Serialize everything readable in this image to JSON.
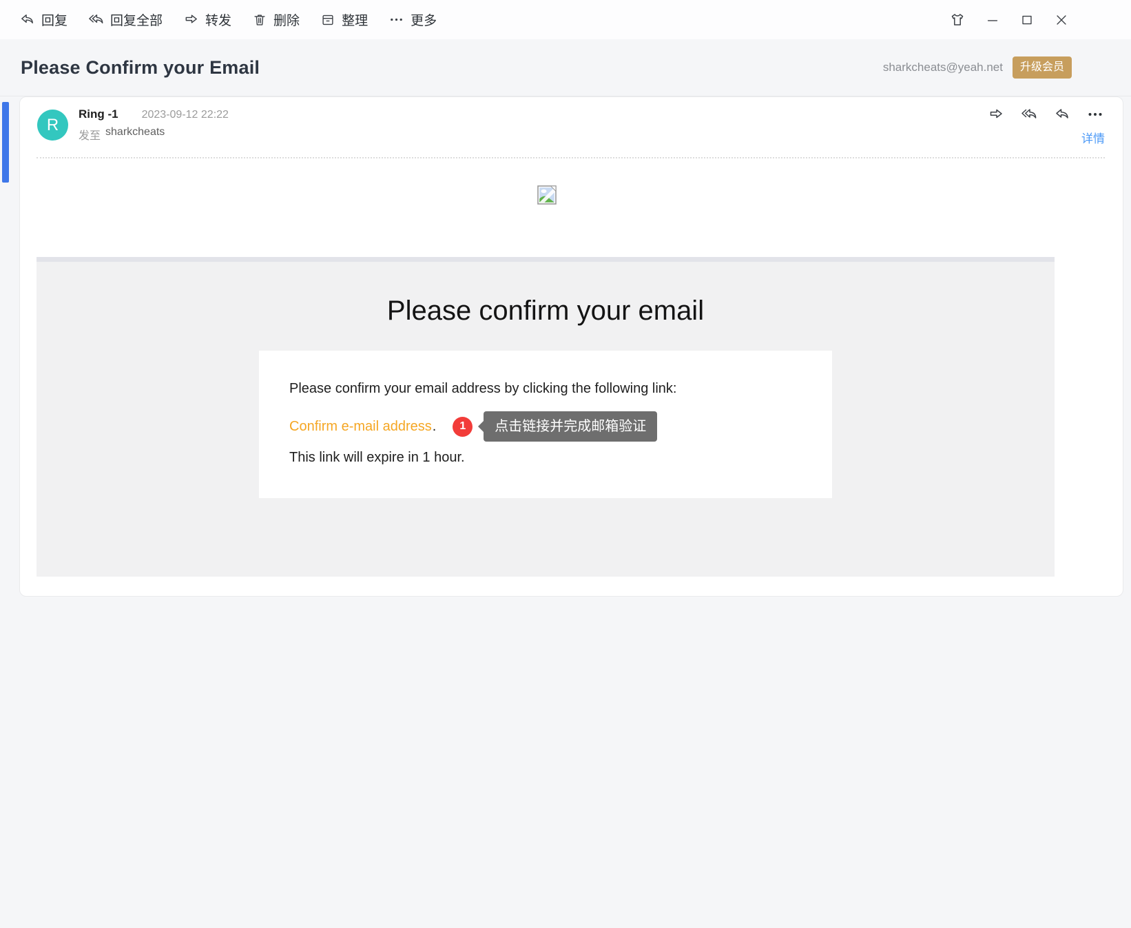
{
  "toolbar": {
    "items": [
      {
        "id": "reply",
        "label": "回复"
      },
      {
        "id": "reply-all",
        "label": "回复全部"
      },
      {
        "id": "forward",
        "label": "转发"
      },
      {
        "id": "delete",
        "label": "删除"
      },
      {
        "id": "organize",
        "label": "整理"
      },
      {
        "id": "more",
        "label": "更多"
      }
    ]
  },
  "subject_bar": {
    "title": "Please Confirm your Email",
    "account": "sharkcheats@yeah.net",
    "upgrade_badge": "升级会员"
  },
  "message": {
    "avatar_letter": "R",
    "sender": "Ring -1",
    "date": "2023-09-12 22:22",
    "to_label": "发至",
    "to_name": "sharkcheats",
    "details_link": "详情"
  },
  "email_body": {
    "heading": "Please confirm your email",
    "line1": "Please confirm your email address by clicking the following link:",
    "link_text": "Confirm e-mail address",
    "link_suffix": ".",
    "line3": "This link will expire in 1 hour.",
    "annotation_number": "1",
    "annotation_tooltip": "点击链接并完成邮箱验证"
  },
  "colors": {
    "accent_blue": "#3e77e9",
    "avatar_teal": "#33c7bf",
    "upgrade_gold": "#c79e5d",
    "link_orange": "#f5a623",
    "badge_red": "#f23c39",
    "tooltip_gray": "#6e6e6e",
    "details_blue": "#4d9af7"
  }
}
